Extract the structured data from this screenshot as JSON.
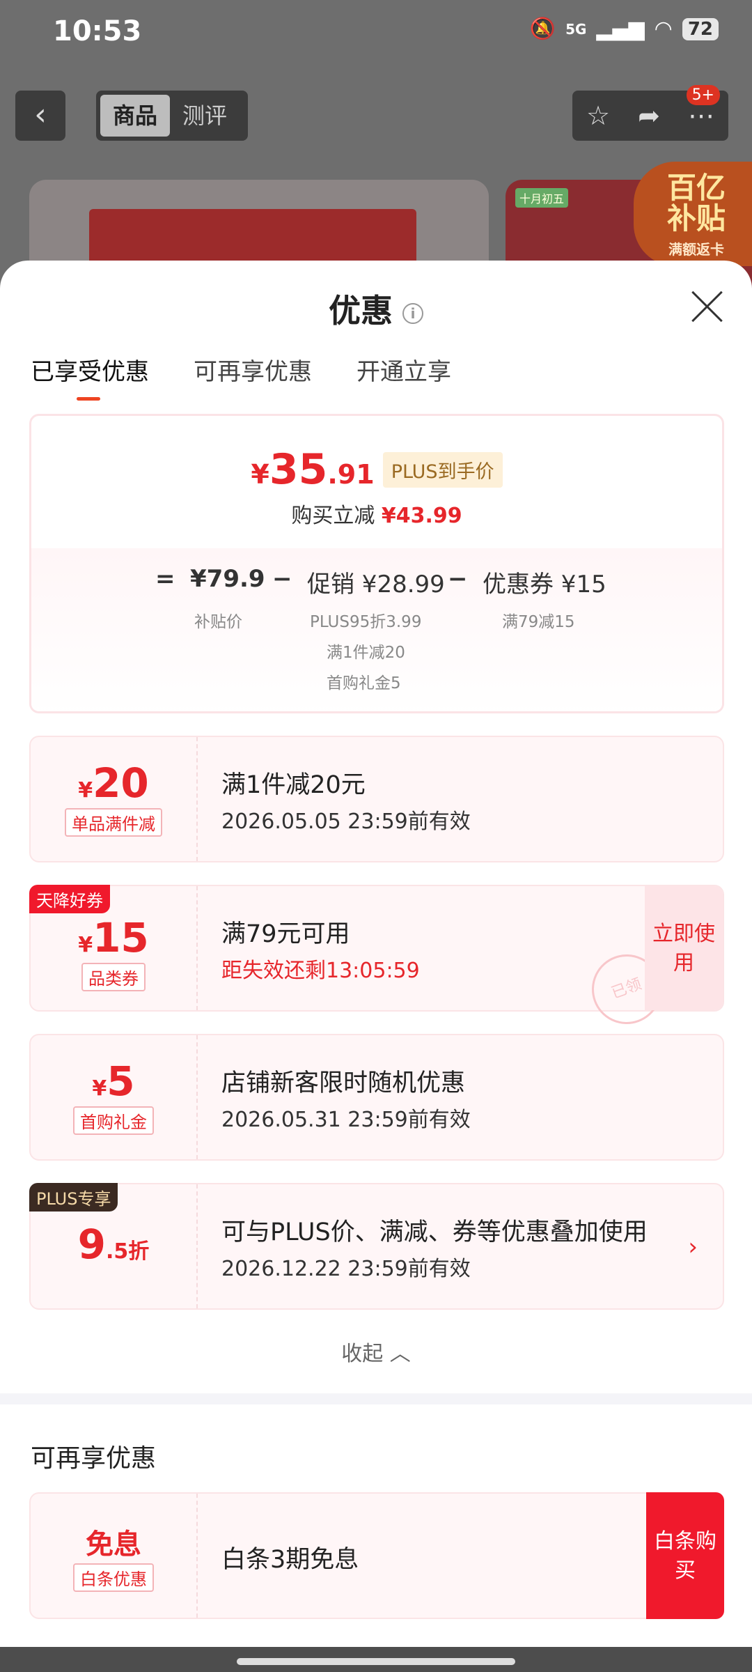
{
  "status_bar": {
    "time": "10:53",
    "network": "5G",
    "battery": "72"
  },
  "top_bar": {
    "tab_goods": "商品",
    "tab_review": "测评",
    "badge": "5+"
  },
  "promo": {
    "line1": "百亿",
    "line2": "补贴",
    "line3": "满额返卡",
    "tag": "十月初五"
  },
  "sheet": {
    "title": "优惠",
    "tabs": [
      "已享受优惠",
      "可再享优惠",
      "开通立享"
    ],
    "summary": {
      "price_symbol": "¥",
      "price_int": "35",
      "price_dec": ".91",
      "plus_tag": "PLUS到手价",
      "save_label": "购买立减",
      "save_value": "¥43.99",
      "eq": "=",
      "minus1": "−",
      "minus2": "−",
      "base_price": "¥79.9",
      "base_label": "补贴价",
      "promo_price": "促销 ¥28.99",
      "promo_sub1": "PLUS95折3.99",
      "promo_sub2": "满1件减20",
      "promo_sub3": "首购礼金5",
      "coupon_price": "优惠券 ¥15",
      "coupon_sub": "满79减15"
    },
    "cards": [
      {
        "symbol": "¥",
        "amount": "20",
        "label": "单品满件减",
        "title": "满1件减20元",
        "desc": "2026.05.05 23:59前有效"
      },
      {
        "corner": "天降好券",
        "symbol": "¥",
        "amount": "15",
        "label": "品类券",
        "title": "满79元可用",
        "desc": "距失效还剩13:05:59",
        "button": "立即使用",
        "stamp": "已领"
      },
      {
        "symbol": "¥",
        "amount": "5",
        "label": "首购礼金",
        "title": "店铺新客限时随机优惠",
        "desc": "2026.05.31 23:59前有效"
      },
      {
        "corner": "PLUS专享",
        "amount": "9",
        "amount_dec": ".5折",
        "title": "可与PLUS价、满减、券等优惠叠加使用",
        "desc": "2026.12.22 23:59前有效"
      }
    ],
    "collapse": "收起",
    "more_section": "可再享优惠",
    "more_card": {
      "amount": "免息",
      "label": "白条优惠",
      "title": "白条3期免息",
      "button": "白条购买"
    }
  }
}
